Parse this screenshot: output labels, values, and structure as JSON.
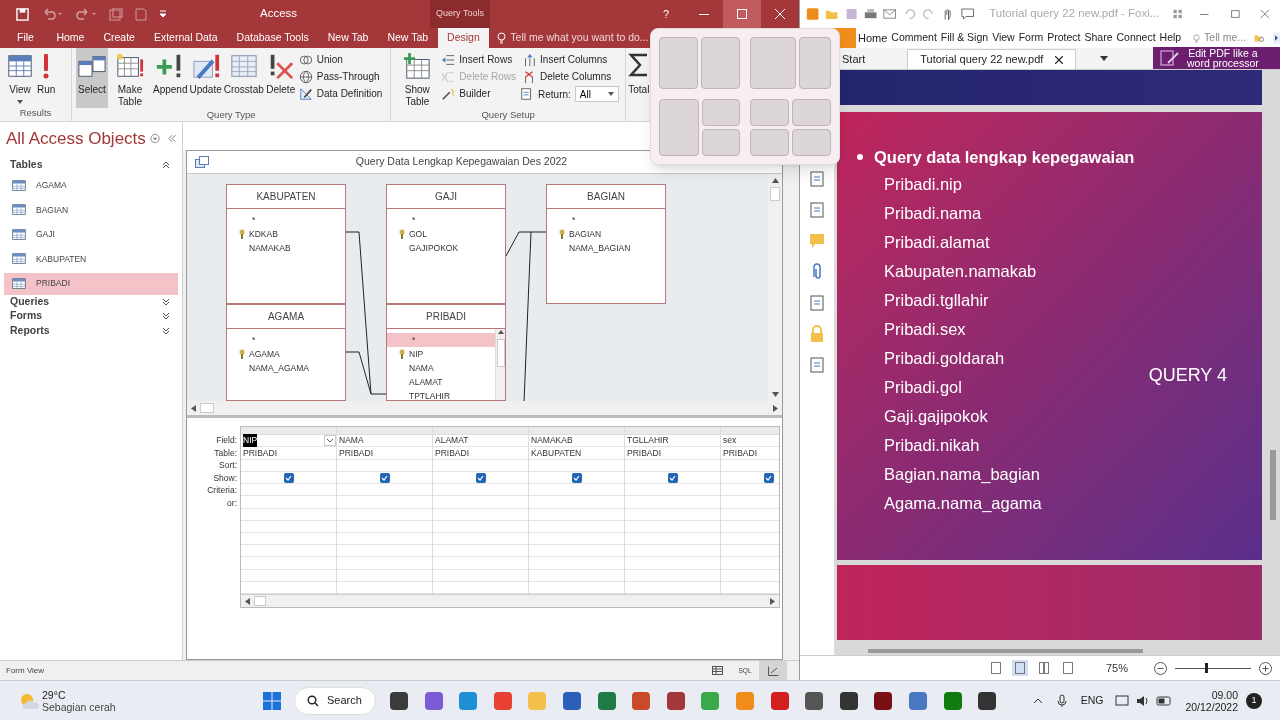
{
  "access": {
    "title": "Access",
    "context_tab": "Query Tools",
    "help": "?",
    "tabs": [
      {
        "label": "File",
        "selected": false
      },
      {
        "label": "Home",
        "selected": false
      },
      {
        "label": "Create",
        "selected": false
      },
      {
        "label": "External Data",
        "selected": false
      },
      {
        "label": "Database Tools",
        "selected": false
      },
      {
        "label": "New Tab",
        "selected": false
      },
      {
        "label": "New Tab",
        "selected": false
      },
      {
        "label": "Design",
        "selected": true
      }
    ],
    "tell_me": "Tell me what you want to do...",
    "ribbon": [
      {
        "label": "Results",
        "buttons": [
          {
            "kind": "view",
            "label": "View",
            "selected": false
          },
          {
            "kind": "run",
            "label": "Run",
            "selected": false
          }
        ]
      },
      {
        "label": "Query Type",
        "buttons": [
          {
            "kind": "select",
            "label": "Select",
            "selected": true
          },
          {
            "kind": "make_table",
            "label": "Make Table",
            "selected": false
          },
          {
            "kind": "append",
            "label": "Append",
            "selected": false
          },
          {
            "kind": "update",
            "label": "Update",
            "selected": false
          },
          {
            "kind": "crosstab",
            "label": "Crosstab",
            "selected": false
          },
          {
            "kind": "delete",
            "label": "Delete",
            "selected": false
          }
        ],
        "small": [
          {
            "kind": "union",
            "label": "Union",
            "disabled": false
          },
          {
            "kind": "pass_through",
            "label": "Pass-Through",
            "disabled": false
          },
          {
            "kind": "data_definition",
            "label": "Data Definition",
            "disabled": false
          }
        ]
      },
      {
        "label": "Query Setup",
        "buttons": [
          {
            "kind": "show_table",
            "label": "Show Table",
            "selected": false
          }
        ],
        "small": [
          {
            "kind": "insert_rows",
            "label": "Insert Rows",
            "disabled": false
          },
          {
            "kind": "delete_rows",
            "label": "Delete Rows",
            "disabled": true
          },
          {
            "kind": "builder",
            "label": "Builder",
            "disabled": false
          },
          {
            "kind": "insert_columns",
            "label": "Insert Columns",
            "disabled": false
          },
          {
            "kind": "delete_columns",
            "label": "Delete Columns",
            "disabled": false
          }
        ],
        "return": {
          "label": "Return:",
          "value": "All"
        }
      }
    ],
    "total": "Total",
    "nav": {
      "title": "All Access Objects",
      "sections": [
        {
          "label": "Tables",
          "expanded": true,
          "items": [
            {
              "label": "AGAMA",
              "selected": false
            },
            {
              "label": "BAGIAN",
              "selected": false
            },
            {
              "label": "GAJI",
              "selected": false
            },
            {
              "label": "KABUPATEN",
              "selected": false
            },
            {
              "label": "PRIBADI",
              "selected": true
            }
          ]
        },
        {
          "label": "Queries",
          "expanded": false
        },
        {
          "label": "Forms",
          "expanded": false
        },
        {
          "label": "Reports",
          "expanded": false
        }
      ]
    },
    "query": {
      "title": "Query Data Lengkap Kepegawaian Des 2022",
      "tables": [
        {
          "name": "KABUPATEN",
          "fields": [
            {
              "name": "*",
              "key": false,
              "selected": false
            },
            {
              "name": "KDKAB",
              "key": true,
              "selected": false
            },
            {
              "name": "NAMAKAB",
              "key": false,
              "selected": false
            }
          ]
        },
        {
          "name": "GAJI",
          "fields": [
            {
              "name": "*",
              "key": false,
              "selected": false
            },
            {
              "name": "GOL",
              "key": true,
              "selected": false
            },
            {
              "name": "GAJIPOKOK",
              "key": false,
              "selected": false
            }
          ]
        },
        {
          "name": "BAGIAN",
          "fields": [
            {
              "name": "*",
              "key": false,
              "selected": false
            },
            {
              "name": "BAGIAN",
              "key": true,
              "selected": false
            },
            {
              "name": "NAMA_BAGIAN",
              "key": false,
              "selected": false
            }
          ]
        },
        {
          "name": "AGAMA",
          "fields": [
            {
              "name": "*",
              "key": false,
              "selected": false
            },
            {
              "name": "AGAMA",
              "key": true,
              "selected": false
            },
            {
              "name": "NAMA_AGAMA",
              "key": false,
              "selected": false
            }
          ]
        },
        {
          "name": "PRIBADI",
          "fields": [
            {
              "name": "*",
              "key": false,
              "selected": true
            },
            {
              "name": "NIP",
              "key": true,
              "selected": false
            },
            {
              "name": "NAMA",
              "key": false,
              "selected": false
            },
            {
              "name": "ALAMAT",
              "key": false,
              "selected": false
            },
            {
              "name": "TPTLAHIR",
              "key": false,
              "selected": false
            }
          ]
        }
      ]
    },
    "grid": {
      "row_labels": [
        "Field:",
        "Table:",
        "Sort:",
        "Show:",
        "Criteria:",
        "or:"
      ],
      "columns": [
        {
          "field": "NIP",
          "table": "PRIBADI",
          "show": true,
          "selected": true
        },
        {
          "field": "NAMA",
          "table": "PRIBADI",
          "show": true,
          "selected": false
        },
        {
          "field": "ALAMAT",
          "table": "PRIBADI",
          "show": true,
          "selected": false
        },
        {
          "field": "NAMAKAB",
          "table": "KABUPATEN",
          "show": true,
          "selected": false
        },
        {
          "field": "TGLLAHIR",
          "table": "PRIBADI",
          "show": true,
          "selected": false
        },
        {
          "field": "sex",
          "table": "PRIBADI",
          "show": true,
          "selected": false
        }
      ]
    },
    "status": "Form View",
    "views": [
      {
        "kind": "datasheet",
        "selected": false
      },
      {
        "kind": "sql",
        "label": "SQL",
        "selected": false
      },
      {
        "kind": "design",
        "selected": true
      }
    ]
  },
  "foxit": {
    "title": "Tutorial query 22 new.pdf - Foxi...",
    "menu": [
      "Home",
      "Comment",
      "Fill & Sign",
      "View",
      "Form",
      "Protect",
      "Share",
      "Connect",
      "Help"
    ],
    "tell_me": "Tell me...",
    "tabs": [
      {
        "label": "Start",
        "selected": false
      },
      {
        "label": "Tutorial query 22 new.pdf",
        "selected": true
      }
    ],
    "promo": [
      "Edit PDF like a",
      "word processor"
    ],
    "slide": {
      "heading": "Query data lengkap kepegawaian",
      "items": [
        "Pribadi.nip",
        "Pribadi.nama",
        "Pribadi.alamat",
        "Kabupaten.namakab",
        "Pribadi.tgllahir",
        "Pribadi.sex",
        "Pribadi.goldarah",
        "Pribadi.gol",
        "Gaji.gajipokok",
        "Pribadi.nikah",
        "Bagian.nama_bagian",
        "Agama.nama_agama"
      ],
      "label": "QUERY 4"
    },
    "views": [
      {
        "selected": false
      },
      {
        "selected": true
      },
      {
        "selected": false
      },
      {
        "selected": false
      }
    ],
    "zoom": "75%",
    "zoom_slider": {
      "level": 0.4
    }
  },
  "taskbar": {
    "temp": "29°C",
    "weather": "Sebagian cerah",
    "search": "Search",
    "lang": "ENG",
    "time": "09.00",
    "date": "20/12/2022",
    "notifications": "1"
  }
}
